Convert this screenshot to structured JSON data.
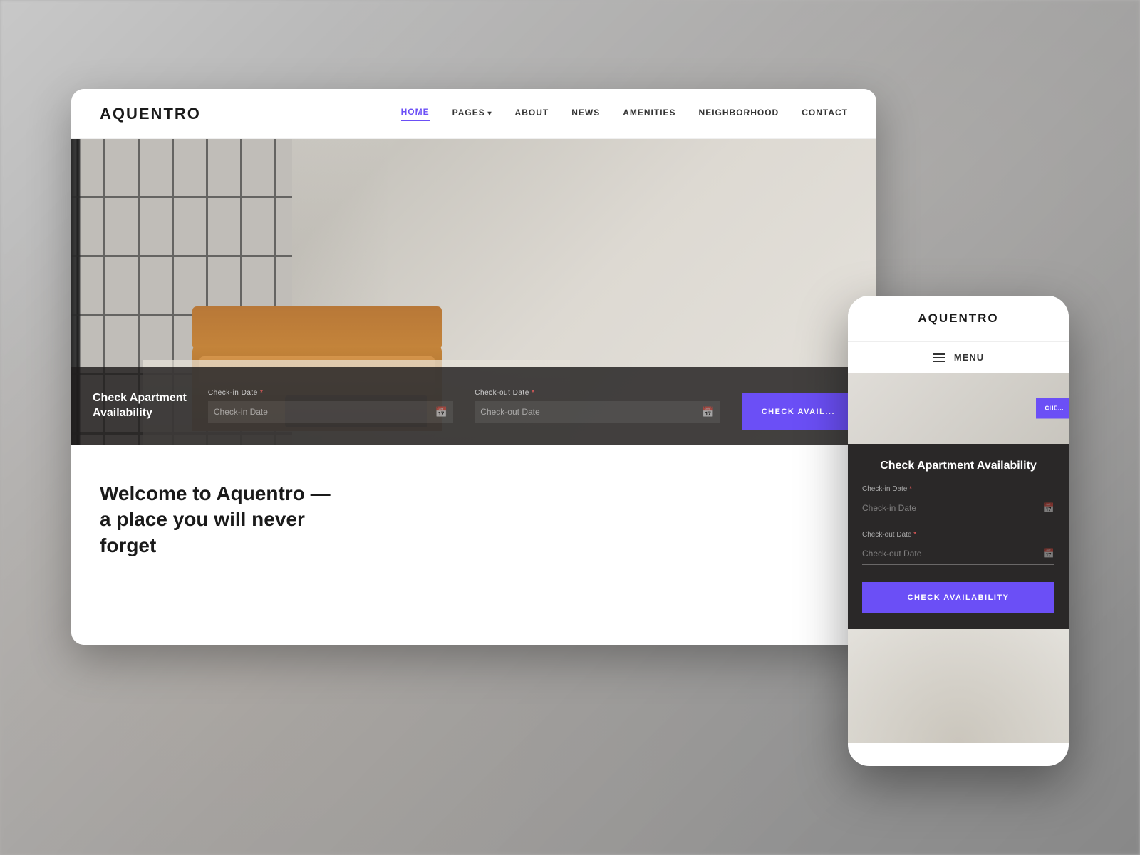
{
  "background": {
    "color": "#b0b0b0"
  },
  "desktop": {
    "logo": "AQUENTRO",
    "nav": {
      "links": [
        {
          "label": "HOME",
          "active": true
        },
        {
          "label": "PAGES",
          "hasArrow": true
        },
        {
          "label": "ABOUT"
        },
        {
          "label": "NEWS"
        },
        {
          "label": "AMENITIES"
        },
        {
          "label": "NEIGHBORHOOD"
        },
        {
          "label": "CONTACT"
        }
      ]
    },
    "hero": {
      "availability": {
        "title": "Check Apartment\nAvailability",
        "checkin_label": "Check-in Date *",
        "checkin_placeholder": "Check-in Date",
        "checkout_label": "Check-out Date *",
        "checkout_placeholder": "Check-out Date",
        "button_label": "CHECK AVAIL..."
      }
    },
    "content": {
      "welcome": "Welcome to Aquentro —\na place you will never forget"
    }
  },
  "mobile": {
    "logo": "AQUENTRO",
    "menu_label": "MENU",
    "hero": {
      "button_label": "CHE..."
    },
    "availability": {
      "title": "Check Apartment Availability",
      "checkin_label": "Check-in Date *",
      "checkin_placeholder": "Check-in Date",
      "checkout_label": "Check-out Date *",
      "checkout_placeholder": "Check-out Date",
      "button_label": "CHECK AVAILABILITY"
    }
  },
  "colors": {
    "accent": "#6b4ff6",
    "dark_bar": "#2a2828",
    "nav_active": "#6b4ff6"
  }
}
